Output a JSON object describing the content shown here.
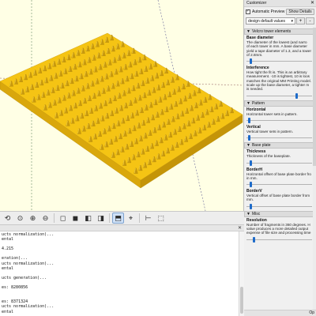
{
  "customizer": {
    "title": "Customizer",
    "auto_preview_label": "Automatic Preview",
    "show_details_label": "Show Details",
    "preset_value": "design default values",
    "add_button": "+",
    "remove_button": "-",
    "auto_preview_checked": true,
    "sections": [
      {
        "title": "Velcro tower elements",
        "params": [
          {
            "name": "Base diameter",
            "desc": [
              "The diameter of the lowest (and narro",
              "of each tower in mm. A base diameter",
              "yield a tape diameter of 1.3, and a tower",
              "of 2.8mm."
            ],
            "slider_fraction": 0.05
          },
          {
            "name": "Interference",
            "desc": [
              "How tight the fit is. This is an arbitrary",
              "measurement. -10 is tightest, 10 is loos",
              "matches the original MM Printing model.",
              "scale up the base diameter, a tighter m",
              "is needed."
            ],
            "slider_fraction": 0.78
          }
        ]
      },
      {
        "title": "Pattern",
        "params": [
          {
            "name": "Horizontal",
            "desc": [
              "Horizontal tower sets in pattern."
            ],
            "slider_fraction": 0.02
          },
          {
            "name": "Vertical",
            "desc": [
              "Vertical tower sets in pattern."
            ],
            "slider_fraction": 0.02
          }
        ]
      },
      {
        "title": "Base plate",
        "params": [
          {
            "name": "Thickness",
            "desc": [
              "Thickness of the baseplate."
            ],
            "slider_fraction": 0.05
          },
          {
            "name": "BorderH",
            "desc": [
              "Horizontal offset of base plate border fro",
              "in mm."
            ],
            "slider_fraction": 0.05
          },
          {
            "name": "BorderV",
            "desc": [
              "Vertical offset of base plate border from",
              "mm."
            ],
            "slider_fraction": 0.05
          }
        ]
      },
      {
        "title": "Misc",
        "params": [
          {
            "name": "Resolution",
            "desc": [
              "Number of fragments in 360 degrees. H",
              "value produces a more detailed output",
              "expense of file size and processing time"
            ],
            "slider_fraction": 0.1
          }
        ]
      }
    ],
    "bottom_label": "Op"
  },
  "console": {
    "lines": [
      "ucts normalization)...",
      "ental",
      "",
      "4.215",
      "",
      "eration)...",
      "ucts normalization)...",
      "ental",
      "",
      "ucts generation)...",
      "",
      "es: 8280856",
      "",
      "",
      "es: 8371324",
      "ucts normalization)...",
      "ental",
      "",
      "4.163"
    ]
  },
  "toolbar": {
    "buttons": [
      {
        "name": "reset-view-icon",
        "glyph": "⟲"
      },
      {
        "name": "view-all-icon",
        "glyph": "⊙"
      },
      {
        "name": "zoom-in-icon",
        "glyph": "⊕"
      },
      {
        "name": "zoom-out-icon",
        "glyph": "⊖"
      },
      {
        "name": "view-top-icon",
        "glyph": "◻"
      },
      {
        "name": "view-bottom-icon",
        "glyph": "◼"
      },
      {
        "name": "view-left-icon",
        "glyph": "◧"
      },
      {
        "name": "view-right-icon",
        "glyph": "◨"
      },
      {
        "name": "perspective-icon",
        "glyph": "⬒"
      },
      {
        "name": "axes-icon",
        "glyph": "⌖"
      },
      {
        "name": "scales-icon",
        "glyph": "⊢"
      },
      {
        "name": "edges-icon",
        "glyph": "⬚"
      }
    ]
  },
  "colors": {
    "viewport_bg": "#ffffe5",
    "model_top": "#f5c414",
    "model_side": "#d9a70c",
    "spike": "#c99a0e",
    "accent": "#1e6bc9"
  }
}
